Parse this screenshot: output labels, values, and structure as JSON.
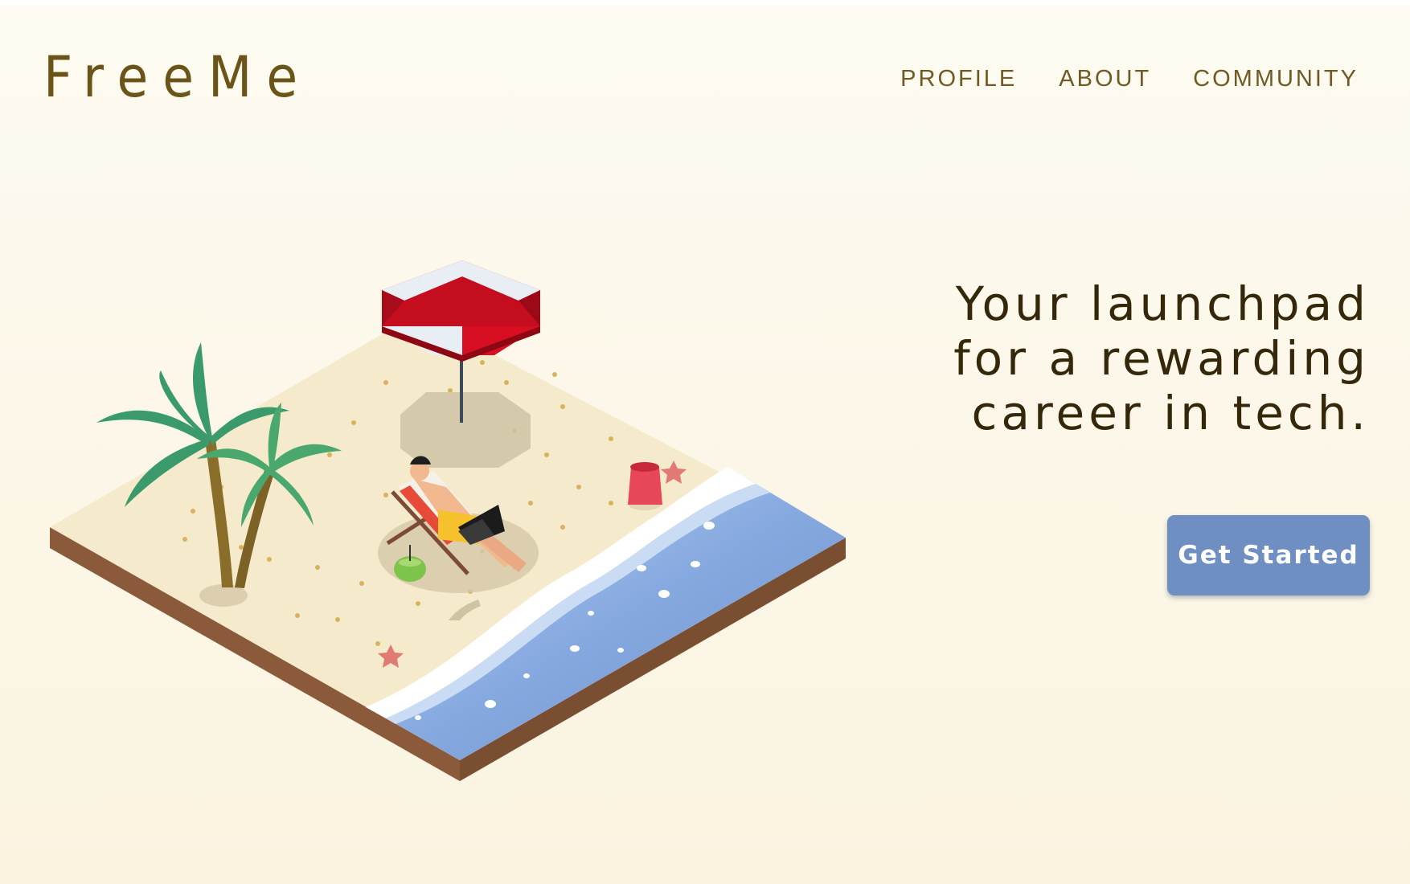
{
  "brand": {
    "logo_text": "FreeMe"
  },
  "nav": {
    "items": [
      {
        "label": "PROFILE"
      },
      {
        "label": "ABOUT"
      },
      {
        "label": "COMMUNITY"
      }
    ]
  },
  "hero": {
    "headline_lines": [
      "Your launchpad",
      "for a rewarding",
      "career in tech."
    ],
    "cta_label": "Get Started",
    "illustration": "isometric-beach-scene"
  },
  "colors": {
    "background": "#fcf8eb",
    "brand_text": "#6b5418",
    "nav_text": "#6f5a25",
    "headline_text": "#35280a",
    "cta_background": "#6f8fc2",
    "cta_text": "#ffffff"
  }
}
